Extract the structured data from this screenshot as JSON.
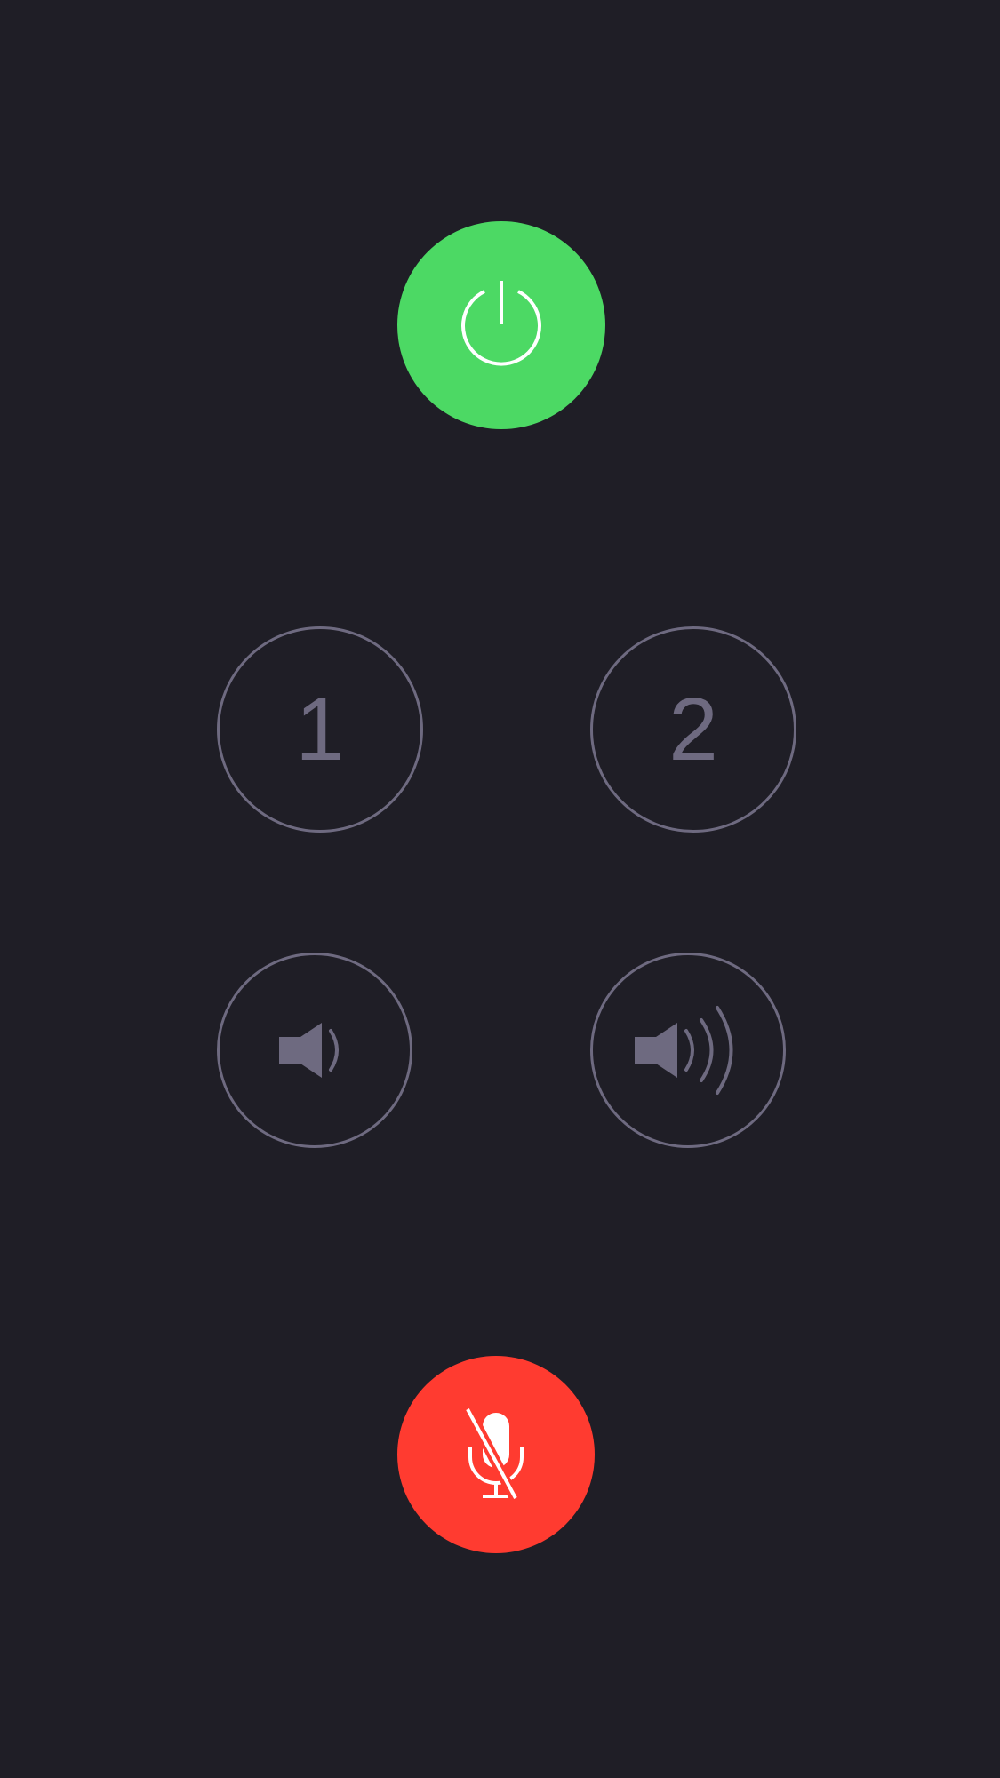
{
  "controls": {
    "power": {
      "icon": "power-icon",
      "state": "on",
      "color": "#4cd964"
    },
    "presets": [
      {
        "label": "1"
      },
      {
        "label": "2"
      }
    ],
    "volume_down": {
      "icon": "volume-low-icon"
    },
    "volume_up": {
      "icon": "volume-high-icon"
    },
    "mute": {
      "icon": "mic-off-icon",
      "state": "muted",
      "color": "#ff3b30"
    }
  },
  "colors": {
    "background": "#1f1e26",
    "outline": "#6e6a80",
    "icon_white": "#ffffff"
  }
}
